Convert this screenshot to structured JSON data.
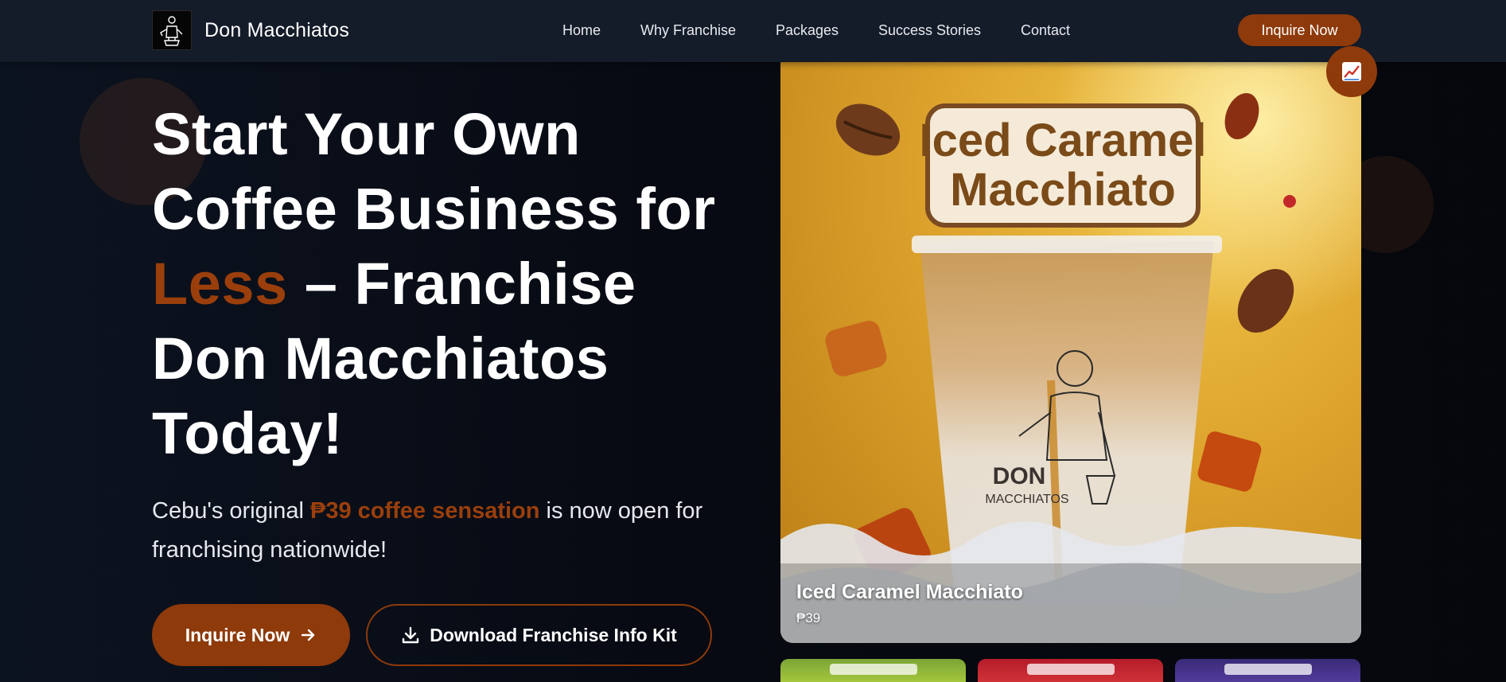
{
  "nav": {
    "brand_name": "Don Macchiatos",
    "links": [
      "Home",
      "Why Franchise",
      "Packages",
      "Success Stories",
      "Contact"
    ],
    "cta_label": "Inquire Now"
  },
  "hero": {
    "title_part1": "Start Your Own Coffee Business for",
    "title_accent": "Less",
    "title_part2": "– Franchise Don Macchiatos Today!",
    "subtitle_part1": "Cebu's original",
    "subtitle_highlight": "₱39 coffee sensation",
    "subtitle_part2": "is now open for franchising nationwide!",
    "primary_button": "Inquire Now",
    "secondary_button": "Download Franchise Info Kit"
  },
  "featured_product": {
    "image_heading_line1": "Iced Caramel",
    "image_heading_line2": "Macchiato",
    "cup_brand_line1": "DON",
    "cup_brand_line2": "MACCHIATOS",
    "name": "Iced Caramel Macchiato",
    "price": "₱39"
  },
  "icons": {
    "trend_badge": "chart-increasing-icon",
    "primary_arrow": "arrow-right-icon",
    "download": "download-icon"
  },
  "colors": {
    "accent": "#8e3a0a",
    "background": "#070a12",
    "navbar": "#141b29"
  }
}
